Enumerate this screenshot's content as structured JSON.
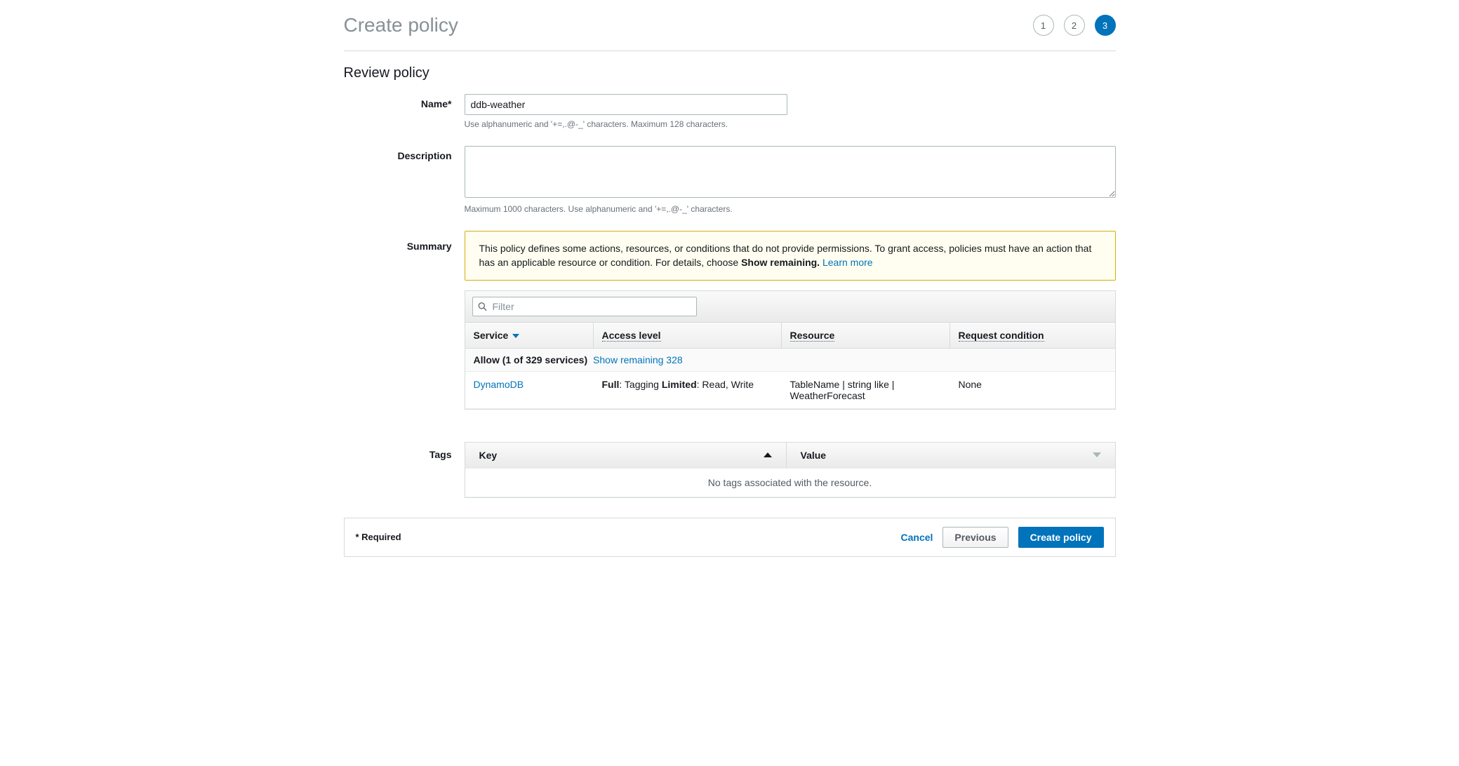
{
  "header": {
    "title": "Create policy",
    "steps": [
      "1",
      "2",
      "3"
    ],
    "active_step_index": 2
  },
  "section_title": "Review policy",
  "form": {
    "name_label": "Name*",
    "name_value": "ddb-weather",
    "name_hint": "Use alphanumeric and '+=,.@-_' characters. Maximum 128 characters.",
    "desc_label": "Description",
    "desc_value": "",
    "desc_hint": "Maximum 1000 characters. Use alphanumeric and '+=,.@-_' characters.",
    "summary_label": "Summary",
    "tags_label": "Tags"
  },
  "warning": {
    "text1": "This policy defines some actions, resources, or conditions that do not provide permissions. To grant access, policies must have an action that has an applicable resource or condition. For details, choose ",
    "strong": "Show remaining.",
    "learn_more": "Learn more"
  },
  "filter": {
    "placeholder": "Filter"
  },
  "columns": {
    "service": "Service",
    "access": "Access level",
    "resource": "Resource",
    "condition": "Request condition"
  },
  "allow_row": {
    "label": "Allow (1 of 329 services)",
    "link": "Show remaining 328"
  },
  "row": {
    "service": "DynamoDB",
    "access_full_label": "Full",
    "access_full_value": ": Tagging ",
    "access_limited_label": "Limited",
    "access_limited_value": ": Read, Write",
    "resource": "TableName | string like | WeatherForecast",
    "condition": "None"
  },
  "tags": {
    "key": "Key",
    "value": "Value",
    "empty": "No tags associated with the resource."
  },
  "footer": {
    "required": "* Required",
    "cancel": "Cancel",
    "previous": "Previous",
    "create": "Create policy"
  }
}
